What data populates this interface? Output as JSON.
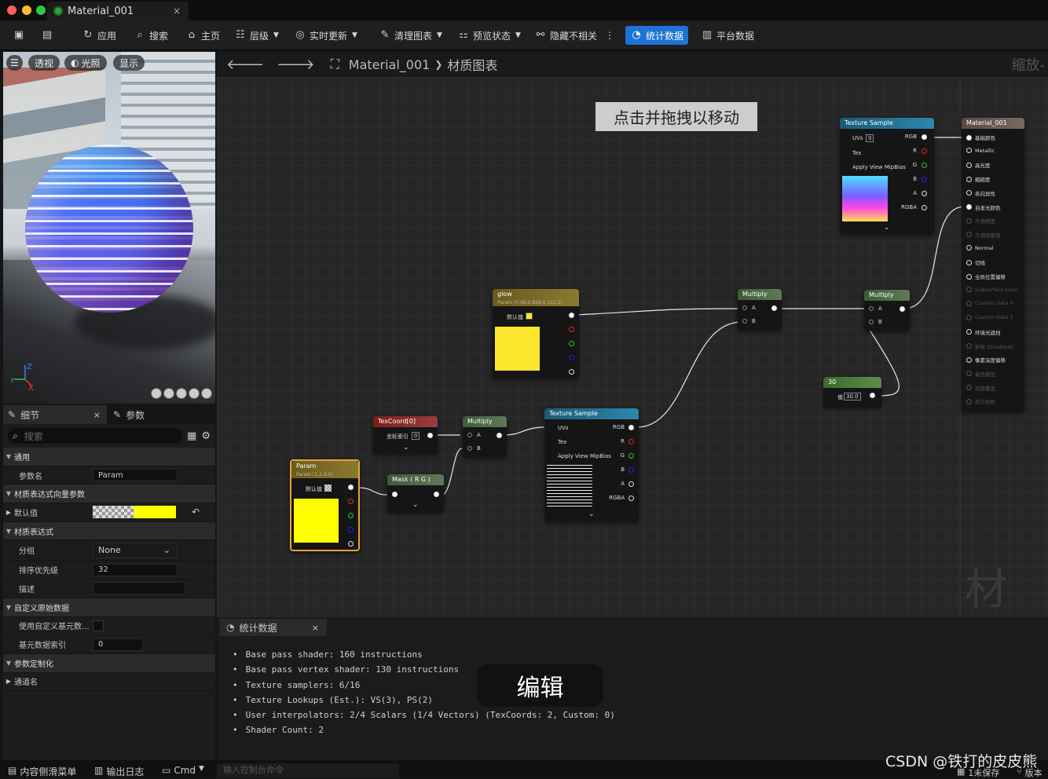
{
  "window": {
    "tab_title": "Material_001",
    "tab_close": "×"
  },
  "toolbar": {
    "apply": "应用",
    "search": "搜索",
    "home": "主页",
    "hierarchy": "层级",
    "live_update": "实时更新",
    "clean_graph": "清理图表",
    "preview_state": "预览状态",
    "hide_unrelated": "隐藏不相关",
    "more": "⋮",
    "stats": "统计数据",
    "platform_stats": "平台数据"
  },
  "viewport": {
    "perspective": "透视",
    "lighting": "光照",
    "show": "显示",
    "axis_z": "Z",
    "axis_x": "X",
    "axis_y": "Y"
  },
  "details": {
    "tab_details": "细节",
    "tab_close": "×",
    "tab_params": "参数",
    "search_placeholder": "搜索",
    "sections": {
      "general": "通用",
      "param_name_label": "参数名",
      "param_name_value": "Param",
      "vector_params": "材质表达式向量参数",
      "default_value": "默认值",
      "material_expr": "材质表达式",
      "group_label": "分组",
      "group_value": "None",
      "sort_priority_label": "排序优先级",
      "sort_priority_value": "32",
      "desc_label": "描述",
      "custom_prim": "自定义原始数据",
      "use_custom_prim": "使用自定义基元数...",
      "prim_index_label": "基元数据索引",
      "prim_index_value": "0",
      "param_custom": "参数定制化",
      "channel_names": "通道名"
    }
  },
  "graph": {
    "breadcrumb_root": "Material_001",
    "breadcrumb_sep": "❯",
    "breadcrumb_leaf": "材质图表",
    "zoom": "缩放-",
    "hint": "点击并拖拽以移动",
    "watermark": "材质",
    "nodes": {
      "tex_sample_top": {
        "title": "Texture Sample",
        "uvs": "UVs",
        "uvs_val": "0",
        "tex": "Tex",
        "mip": "Apply View MipBias",
        "rgb": "RGB",
        "r": "R",
        "g": "G",
        "b": "B",
        "a": "A",
        "rgba": "RGBA"
      },
      "material": {
        "title": "Material_001",
        "pins": [
          "基础颜色",
          "Metallic",
          "高光度",
          "粗糙度",
          "各向异性",
          "自发光颜色",
          "不透明度",
          "不透明蒙版",
          "Normal",
          "切线",
          "全局位置偏移",
          "Subsurface Color",
          "Custom Data 0",
          "Custom Data 1",
          "环境光遮挡",
          "折射 (Disabled)",
          "像素深度偏移",
          "着色模型",
          "前面覆盖",
          "后方材质"
        ]
      },
      "glow": {
        "title": "glow",
        "sub": "Param (0.99,0.859,0.111,1)",
        "default": "默认值"
      },
      "multiply1": {
        "title": "Multiply",
        "a": "A",
        "b": "B"
      },
      "multiply2": {
        "title": "Multiply",
        "a": "A",
        "b": "B"
      },
      "multiply3": {
        "title": "Multiply",
        "a": "A",
        "b": "B"
      },
      "const30": {
        "title": "30",
        "val_label": "值",
        "val": "30.0"
      },
      "texcoord": {
        "title": "TexCoord[0]",
        "idx_label": "坐标索引",
        "idx_val": "0"
      },
      "tex_sample_mid": {
        "title": "Texture Sample",
        "uvs": "UVs",
        "tex": "Tex",
        "mip": "Apply View MipBias",
        "rgb": "RGB",
        "r": "R",
        "g": "G",
        "b": "B",
        "a": "A",
        "rgba": "RGBA"
      },
      "mask": {
        "title": "Mask ( R G )"
      },
      "param": {
        "title": "Param",
        "sub": "Param (1,1,0,0)",
        "default": "默认值"
      }
    }
  },
  "stats": {
    "tab": "统计数据",
    "close": "×",
    "lines": [
      "Base pass shader: 160 instructions",
      "Base pass vertex shader: 130 instructions",
      "Texture samplers: 6/16",
      "Texture Lookups (Est.): VS(3), PS(2)",
      "User interpolators: 2/4 Scalars (1/4 Vectors) (TexCoords: 2, Custom: 0)",
      "Shader Count: 2"
    ],
    "edit_badge": "编辑"
  },
  "status": {
    "content_drawer": "内容侧滑菜单",
    "output_log": "输出日志",
    "cmd": "Cmd",
    "console_placeholder": "输入控制台命令",
    "unsaved": "1未保存",
    "version": "版本"
  },
  "watermark": "CSDN @铁打的皮皮熊",
  "colors": {
    "accent": "#1d73d6",
    "glow": "#fce62e",
    "param": "#ffff00",
    "node_param_header": "#6b5a1c",
    "node_multiply_header": "#4c6a44",
    "node_texcoord_header": "#7a1d1d",
    "node_texture_header": "#1f5d7a",
    "node_material_header": "#5a4a42"
  }
}
